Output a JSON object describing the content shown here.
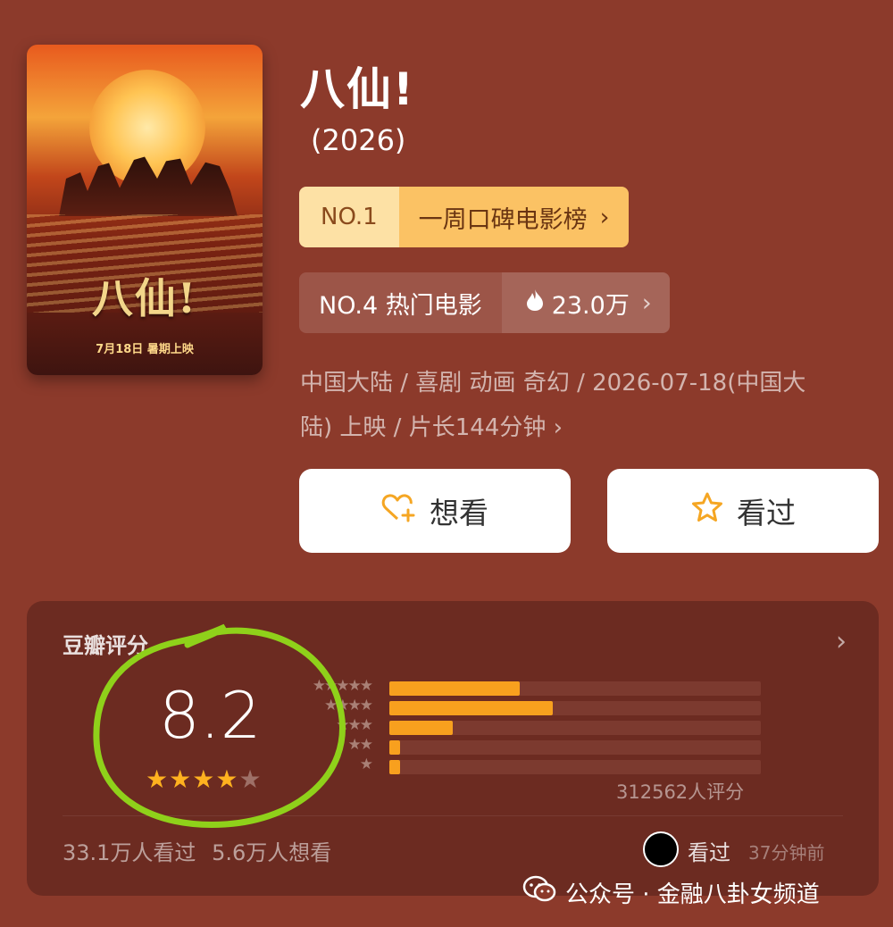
{
  "movie": {
    "title": "八仙!",
    "year": "(2026)",
    "poster": {
      "title": "八仙!",
      "date": "7月18日 暑期上映"
    }
  },
  "rank_primary": {
    "number": "NO.1",
    "label": "一周口碑电影榜"
  },
  "rank_secondary": {
    "label": "NO.4 热门电影",
    "heat": "23.0万"
  },
  "meta": {
    "line1": "中国大陆 / 喜剧 动画 奇幻 / 2026-07-18(中国大",
    "line2": "陆) 上映 / 片长144分钟"
  },
  "actions": {
    "want_label": "想看",
    "seen_label": "看过"
  },
  "rating": {
    "section_title": "豆瓣评分",
    "score": "8.2",
    "star_level": 4,
    "distribution": [
      {
        "stars": "★★★★★",
        "fraction": 0.35
      },
      {
        "stars": "★★★★",
        "fraction": 0.44
      },
      {
        "stars": "★★★",
        "fraction": 0.17
      },
      {
        "stars": "★★",
        "fraction": 0.03
      },
      {
        "stars": "★",
        "fraction": 0.03
      }
    ],
    "count_text": "312562人评分",
    "watched_text": "33.1万人看过",
    "want_text": "5.6万人想看",
    "recent_label": "看过",
    "recent_time": "37分钟前"
  },
  "colors": {
    "background": "#8c3a2b",
    "card": "#6c2b21",
    "accent_orange": "#f8a01e",
    "annotation_green": "#8fd11a"
  },
  "watermark": {
    "text": "公众号 · 金融八卦女频道"
  }
}
